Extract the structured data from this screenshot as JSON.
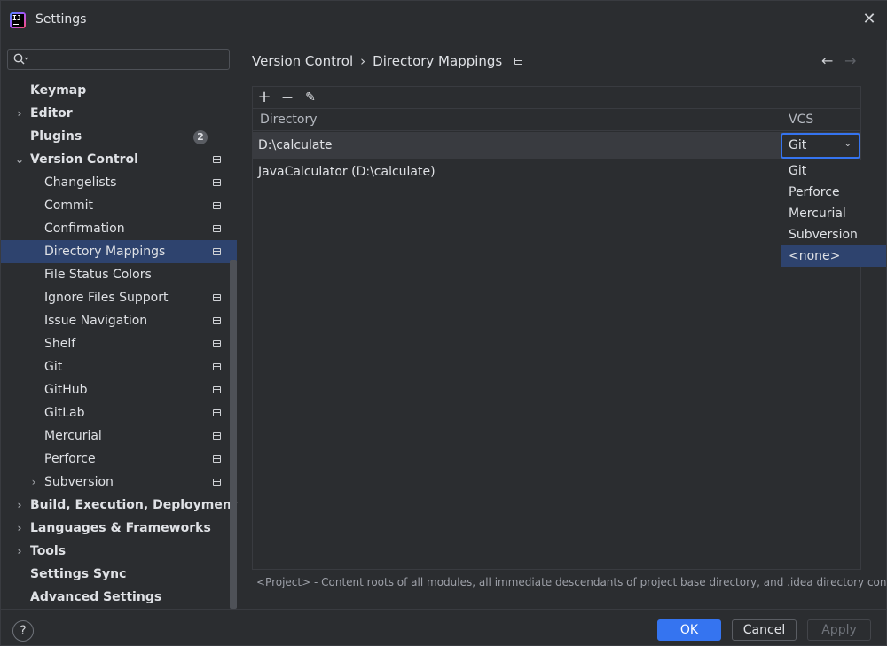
{
  "window": {
    "title": "Settings",
    "app_icon_text": "IJ"
  },
  "search": {
    "placeholder": "",
    "value": ""
  },
  "sidebar": {
    "items": [
      {
        "label": "Keymap",
        "level": 0,
        "chevron": "",
        "bold": true,
        "project": false
      },
      {
        "label": "Editor",
        "level": 0,
        "chevron": "›",
        "bold": true,
        "project": false
      },
      {
        "label": "Plugins",
        "level": 0,
        "chevron": "",
        "bold": true,
        "project": false,
        "badge": "2"
      },
      {
        "label": "Version Control",
        "level": 0,
        "chevron": "⌄",
        "bold": true,
        "project": true
      },
      {
        "label": "Changelists",
        "level": 1,
        "chevron": "",
        "bold": false,
        "project": true
      },
      {
        "label": "Commit",
        "level": 1,
        "chevron": "",
        "bold": false,
        "project": true
      },
      {
        "label": "Confirmation",
        "level": 1,
        "chevron": "",
        "bold": false,
        "project": true
      },
      {
        "label": "Directory Mappings",
        "level": 1,
        "chevron": "",
        "bold": false,
        "project": true,
        "selected": true
      },
      {
        "label": "File Status Colors",
        "level": 1,
        "chevron": "",
        "bold": false,
        "project": false
      },
      {
        "label": "Ignore Files Support",
        "level": 1,
        "chevron": "",
        "bold": false,
        "project": true
      },
      {
        "label": "Issue Navigation",
        "level": 1,
        "chevron": "",
        "bold": false,
        "project": true
      },
      {
        "label": "Shelf",
        "level": 1,
        "chevron": "",
        "bold": false,
        "project": true
      },
      {
        "label": "Git",
        "level": 1,
        "chevron": "",
        "bold": false,
        "project": true
      },
      {
        "label": "GitHub",
        "level": 1,
        "chevron": "",
        "bold": false,
        "project": true
      },
      {
        "label": "GitLab",
        "level": 1,
        "chevron": "",
        "bold": false,
        "project": true
      },
      {
        "label": "Mercurial",
        "level": 1,
        "chevron": "",
        "bold": false,
        "project": true
      },
      {
        "label": "Perforce",
        "level": 1,
        "chevron": "",
        "bold": false,
        "project": true
      },
      {
        "label": "Subversion",
        "level": 1,
        "chevron": "›",
        "bold": false,
        "project": true
      },
      {
        "label": "Build, Execution, Deployment",
        "level": 0,
        "chevron": "›",
        "bold": true,
        "project": false
      },
      {
        "label": "Languages & Frameworks",
        "level": 0,
        "chevron": "›",
        "bold": true,
        "project": false
      },
      {
        "label": "Tools",
        "level": 0,
        "chevron": "›",
        "bold": true,
        "project": false
      },
      {
        "label": "Settings Sync",
        "level": 0,
        "chevron": "",
        "bold": true,
        "project": false
      },
      {
        "label": "Advanced Settings",
        "level": 0,
        "chevron": "",
        "bold": true,
        "project": false
      }
    ]
  },
  "breadcrumb": {
    "parent": "Version Control",
    "separator": "›",
    "current": "Directory Mappings"
  },
  "nav": {
    "back": "←",
    "forward": "→"
  },
  "toolbar": {
    "add": "+",
    "remove": "—",
    "edit": "✎"
  },
  "table": {
    "columns": [
      "Directory",
      "VCS"
    ],
    "rows": [
      {
        "directory": "D:\\calculate",
        "vcs": "Git",
        "selected": true
      },
      {
        "directory": "JavaCalculator (D:\\calculate)",
        "vcs": "",
        "selected": false
      }
    ]
  },
  "vcs_combo": {
    "value": "Git",
    "options": [
      "Git",
      "Perforce",
      "Mercurial",
      "Subversion",
      "<none>"
    ],
    "highlighted": "<none>"
  },
  "footnote": "<Project> - Content roots of all modules, all immediate descendants of project base directory, and .idea directory contents",
  "buttons": {
    "help": "?",
    "ok": "OK",
    "cancel": "Cancel",
    "apply": "Apply"
  },
  "colors": {
    "accent": "#3574f0",
    "selection": "#2e436e",
    "background": "#2b2d30"
  }
}
